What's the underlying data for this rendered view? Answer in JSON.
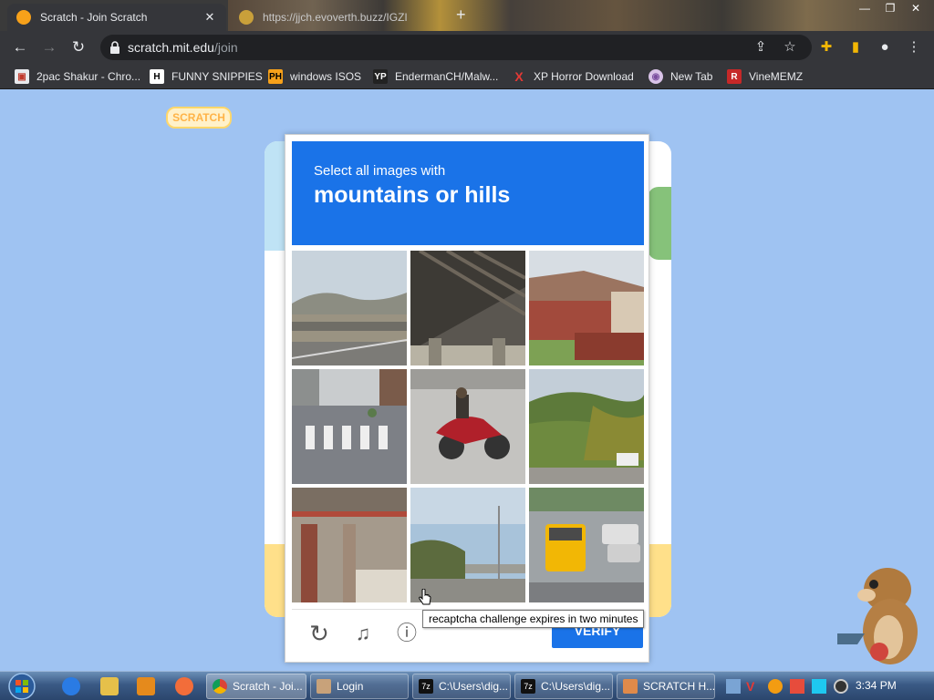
{
  "browser": {
    "tabs": [
      {
        "title": "Scratch - Join Scratch",
        "active": true,
        "favicon": "scratch-cat-icon"
      },
      {
        "title": "https://jjch.evoverth.buzz/IGZI",
        "active": false,
        "favicon": "globe-icon"
      }
    ],
    "new_tab_label": "+",
    "window_controls": {
      "minimize": "—",
      "restore": "❐",
      "close": "✕"
    },
    "url_host": "scratch.mit.edu",
    "url_path": "/join",
    "bookmarks": [
      {
        "label": "2pac Shakur - Chro...",
        "icon": "chrome-store-icon"
      },
      {
        "label": "FUNNY SNIPPIES",
        "icon": "H"
      },
      {
        "label": "windows ISOS",
        "icon": "PH"
      },
      {
        "label": "EndermanCH/Malw...",
        "icon": "YP"
      },
      {
        "label": "XP Horror Download",
        "icon": "X"
      },
      {
        "label": "New Tab",
        "icon": "globe-icon"
      },
      {
        "label": "VineMEMZ",
        "icon": "R"
      }
    ]
  },
  "page": {
    "logo_text": "SCRATCH"
  },
  "captcha": {
    "instruction": "Select all images with",
    "target": "mountains or hills",
    "tiles": [
      "highway-overpass-mountains",
      "bridge-underside",
      "brick-house",
      "crosswalk-street",
      "motorcycle",
      "forested-hills",
      "parking-garage",
      "highway-hills",
      "traffic-taxi"
    ],
    "verify_label": "VERIFY",
    "tooltip": "recaptcha challenge expires in two minutes"
  },
  "taskbar": {
    "tasks": [
      {
        "label": "Scratch - Joi...",
        "icon": "chrome-icon",
        "active": true
      },
      {
        "label": "Login",
        "icon": "app-icon",
        "active": false
      },
      {
        "label": "C:\\Users\\dig...",
        "icon": "7zip-icon",
        "active": false
      },
      {
        "label": "C:\\Users\\dig...",
        "icon": "7zip-icon",
        "active": false
      },
      {
        "label": "SCRATCH H...",
        "icon": "tool-icon",
        "active": false
      }
    ],
    "clock": "3:34 PM"
  },
  "colors": {
    "captcha_blue": "#1a73e8",
    "page_bg": "#9fc3f2",
    "chrome_dark": "#35363a"
  }
}
